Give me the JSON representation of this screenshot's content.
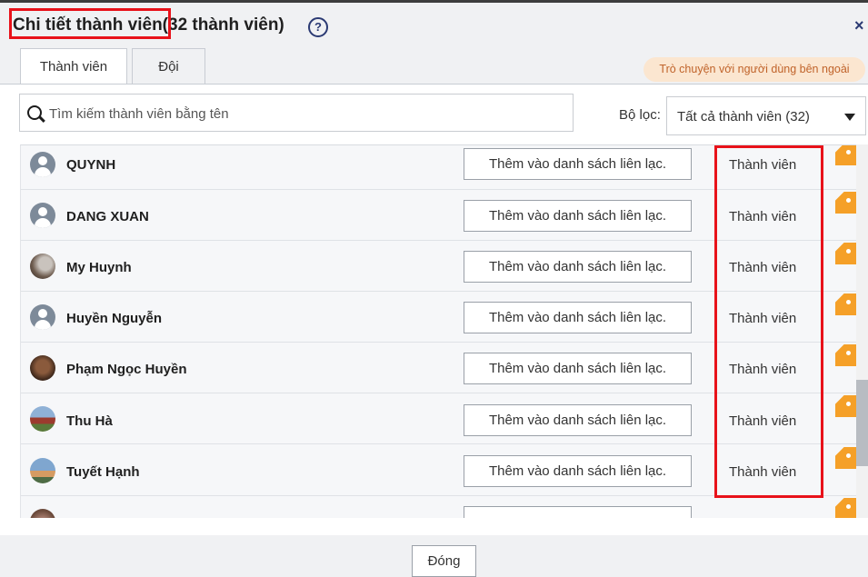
{
  "dialog": {
    "title": "Chi tiết thành viên(32 thành viên)",
    "help_icon": "question-circle-icon",
    "close_icon": "×"
  },
  "tabs": [
    {
      "label": "Thành viên",
      "active": true
    },
    {
      "label": "Đội",
      "active": false
    }
  ],
  "external_badge": "Trò chuyện với người dùng bên ngoài",
  "search": {
    "placeholder": "Tìm kiếm thành viên bằng tên",
    "value": ""
  },
  "filter": {
    "label": "Bộ lọc:",
    "selected": "Tất cả thành viên (32)"
  },
  "members": [
    {
      "name": "QUYNH",
      "avatar": "default",
      "action": "Thêm vào danh sách liên lạc.",
      "role": "Thành viên"
    },
    {
      "name": "DANG XUAN",
      "avatar": "default",
      "action": "Thêm vào danh sách liên lạc.",
      "role": "Thành viên"
    },
    {
      "name": "My Huynh",
      "avatar": "photo",
      "action": "Thêm vào danh sách liên lạc.",
      "role": "Thành viên"
    },
    {
      "name": "Huyền Nguyễn",
      "avatar": "default",
      "action": "Thêm vào danh sách liên lạc.",
      "role": "Thành viên"
    },
    {
      "name": "Phạm Ngọc Huyền",
      "avatar": "photo",
      "action": "Thêm vào danh sách liên lạc.",
      "role": "Thành viên"
    },
    {
      "name": "Thu Hà",
      "avatar": "photo",
      "action": "Thêm vào danh sách liên lạc.",
      "role": "Thành viên"
    },
    {
      "name": "Tuyết Hạnh",
      "avatar": "photo",
      "action": "Thêm vào danh sách liên lạc.",
      "role": "Thành viên"
    }
  ],
  "colors": {
    "highlight": "#e8121a",
    "guest_badge": "#f5a028",
    "external_badge_bg": "#fbe6d0"
  },
  "footer": {
    "close_label": "Đóng"
  }
}
